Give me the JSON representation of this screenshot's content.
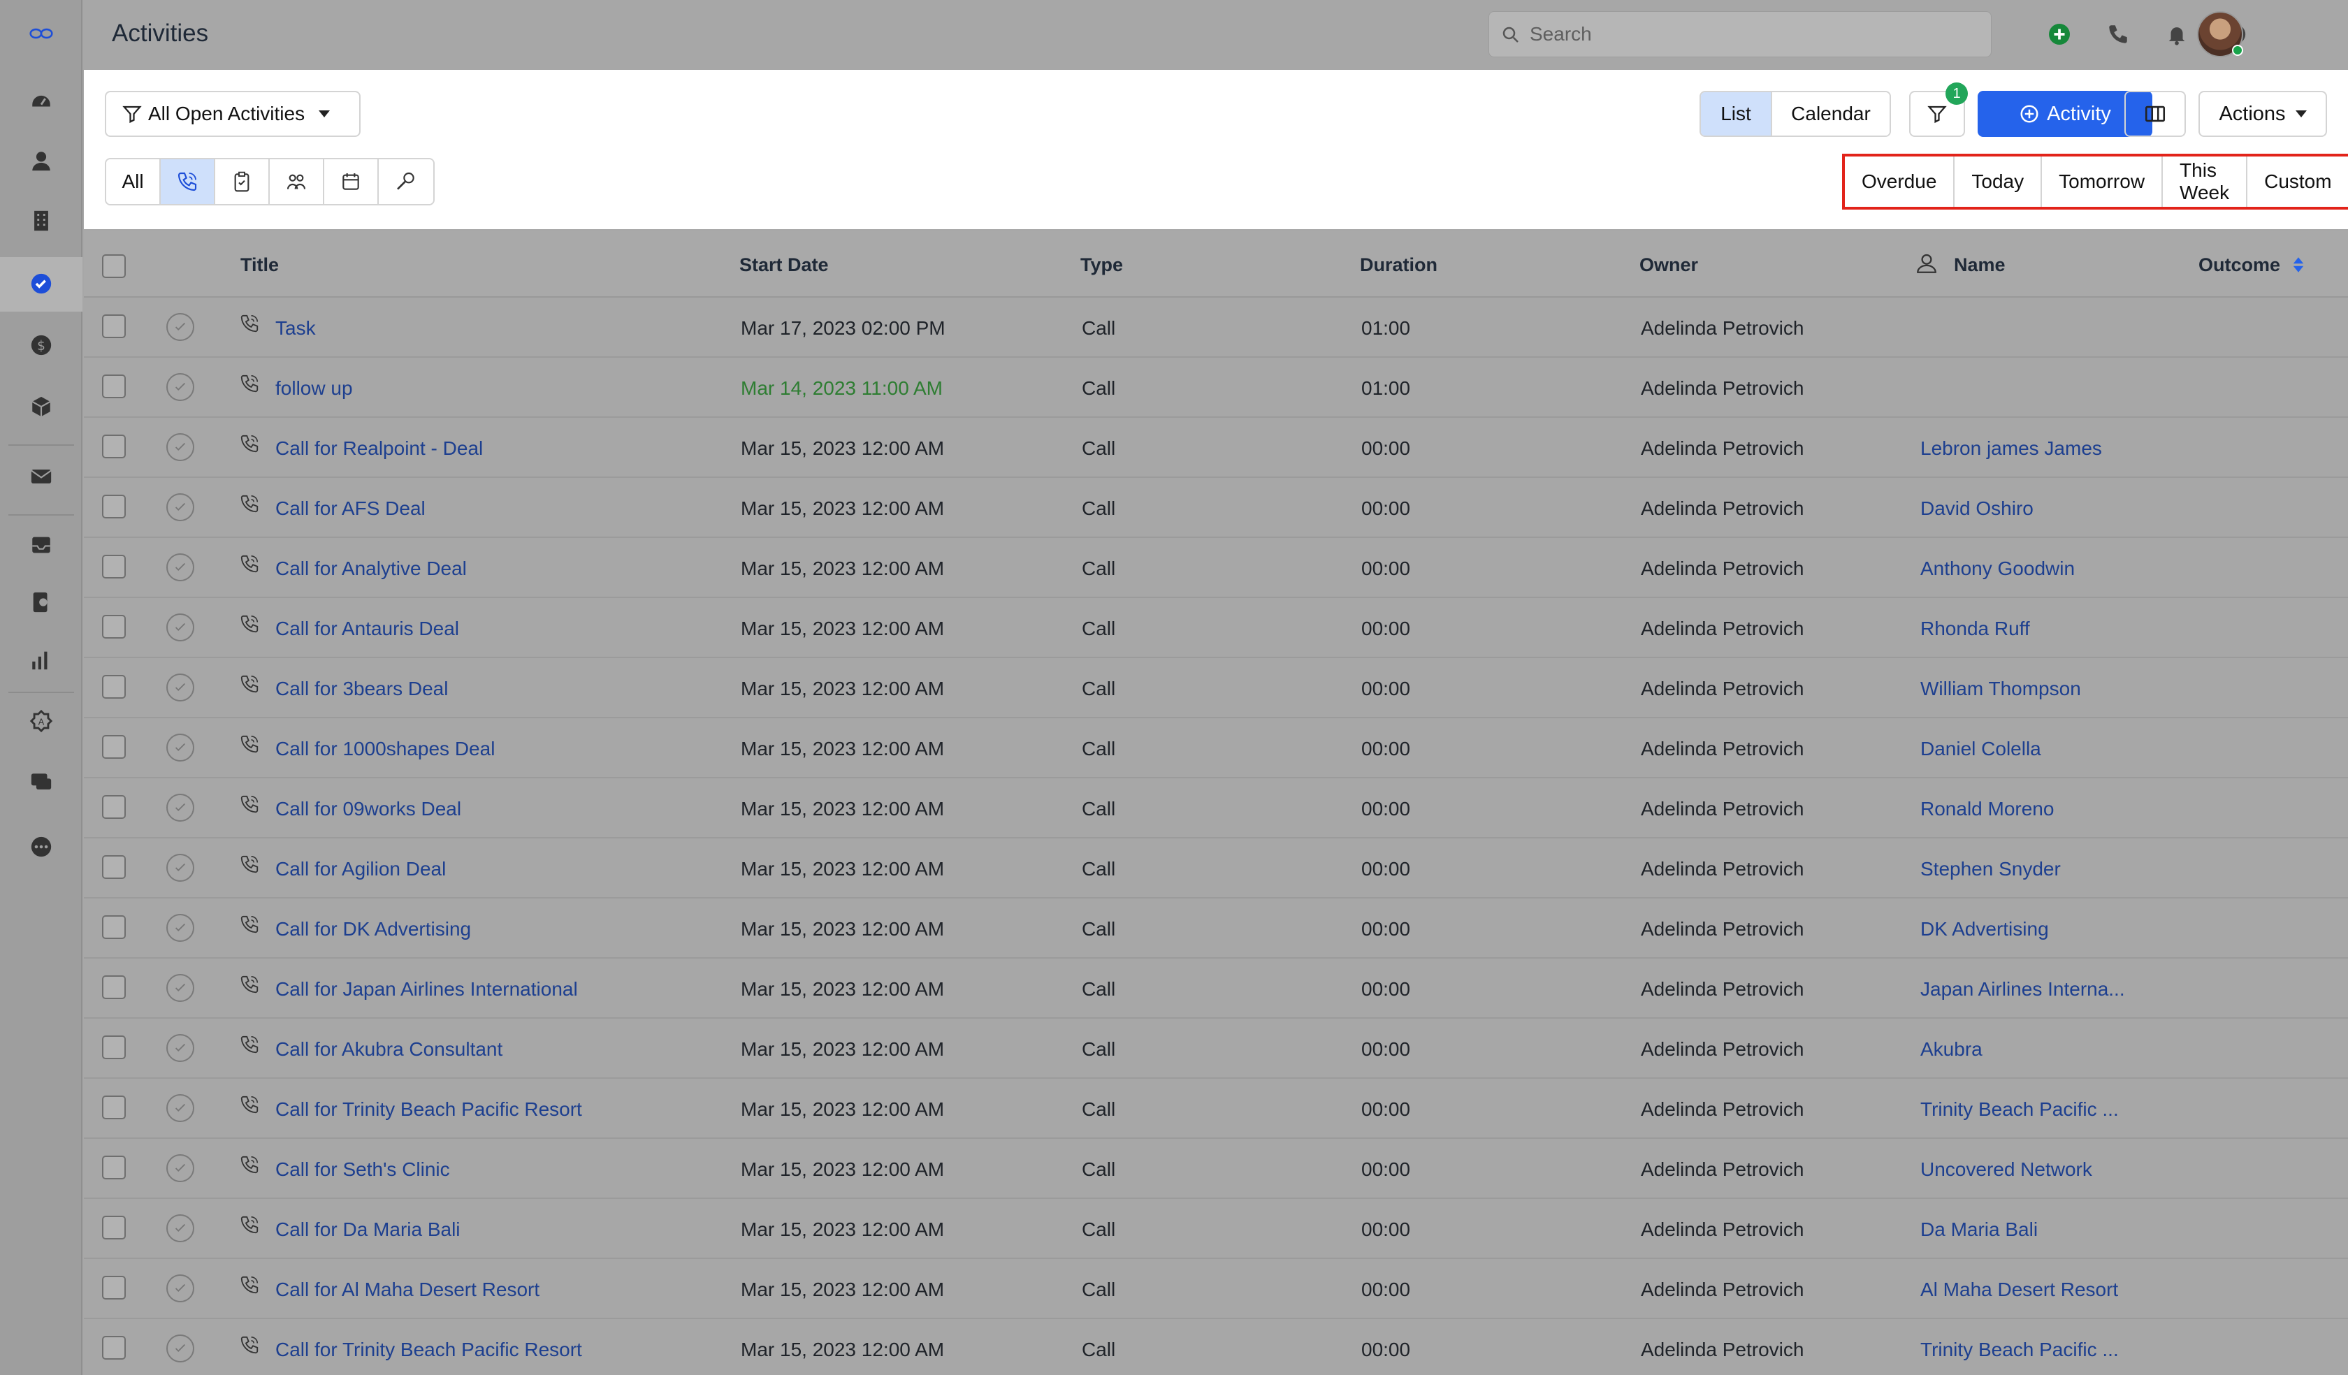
{
  "header": {
    "title": "Activities"
  },
  "search": {
    "placeholder": "Search"
  },
  "toolbar": {
    "view_filter": "All Open Activities",
    "view_modes": [
      "List",
      "Calendar"
    ],
    "filter_count": "1",
    "add_activity": "Activity",
    "actions": "Actions",
    "type_all": "All",
    "date_filters": [
      "Overdue",
      "Today",
      "Tomorrow",
      "This Week",
      "Custom"
    ]
  },
  "table": {
    "columns": {
      "title": "Title",
      "start_date": "Start Date",
      "type": "Type",
      "duration": "Duration",
      "owner": "Owner",
      "name": "Name",
      "outcome": "Outcome"
    },
    "rows": [
      {
        "title": "Task",
        "start_date": "Mar 17, 2023 02:00 PM",
        "type": "Call",
        "duration": "01:00",
        "owner": "Adelinda Petrovich",
        "name": ""
      },
      {
        "title": "follow up",
        "start_date": "Mar 14, 2023 11:00 AM",
        "type": "Call",
        "duration": "01:00",
        "owner": "Adelinda Petrovich",
        "name": ""
      },
      {
        "title": "Call for Realpoint - Deal",
        "start_date": "Mar 15, 2023 12:00 AM",
        "type": "Call",
        "duration": "00:00",
        "owner": "Adelinda Petrovich",
        "name": "Lebron james James"
      },
      {
        "title": "Call for AFS Deal",
        "start_date": "Mar 15, 2023 12:00 AM",
        "type": "Call",
        "duration": "00:00",
        "owner": "Adelinda Petrovich",
        "name": "David Oshiro"
      },
      {
        "title": "Call for Analytive Deal",
        "start_date": "Mar 15, 2023 12:00 AM",
        "type": "Call",
        "duration": "00:00",
        "owner": "Adelinda Petrovich",
        "name": "Anthony Goodwin"
      },
      {
        "title": "Call for Antauris Deal",
        "start_date": "Mar 15, 2023 12:00 AM",
        "type": "Call",
        "duration": "00:00",
        "owner": "Adelinda Petrovich",
        "name": "Rhonda Ruff"
      },
      {
        "title": "Call for 3bears Deal",
        "start_date": "Mar 15, 2023 12:00 AM",
        "type": "Call",
        "duration": "00:00",
        "owner": "Adelinda Petrovich",
        "name": "William Thompson"
      },
      {
        "title": "Call for 1000shapes Deal",
        "start_date": "Mar 15, 2023 12:00 AM",
        "type": "Call",
        "duration": "00:00",
        "owner": "Adelinda Petrovich",
        "name": "Daniel Colella"
      },
      {
        "title": "Call for 09works Deal",
        "start_date": "Mar 15, 2023 12:00 AM",
        "type": "Call",
        "duration": "00:00",
        "owner": "Adelinda Petrovich",
        "name": "Ronald Moreno"
      },
      {
        "title": "Call for Agilion Deal",
        "start_date": "Mar 15, 2023 12:00 AM",
        "type": "Call",
        "duration": "00:00",
        "owner": "Adelinda Petrovich",
        "name": "Stephen Snyder"
      },
      {
        "title": "Call for DK Advertising",
        "start_date": "Mar 15, 2023 12:00 AM",
        "type": "Call",
        "duration": "00:00",
        "owner": "Adelinda Petrovich",
        "name": "DK Advertising"
      },
      {
        "title": "Call for Japan Airlines International",
        "start_date": "Mar 15, 2023 12:00 AM",
        "type": "Call",
        "duration": "00:00",
        "owner": "Adelinda Petrovich",
        "name": "Japan Airlines Interna..."
      },
      {
        "title": "Call for Akubra Consultant",
        "start_date": "Mar 15, 2023 12:00 AM",
        "type": "Call",
        "duration": "00:00",
        "owner": "Adelinda Petrovich",
        "name": "Akubra"
      },
      {
        "title": "Call for Trinity Beach Pacific Resort",
        "start_date": "Mar 15, 2023 12:00 AM",
        "type": "Call",
        "duration": "00:00",
        "owner": "Adelinda Petrovich",
        "name": "Trinity Beach Pacific ..."
      },
      {
        "title": "Call for Seth's Clinic",
        "start_date": "Mar 15, 2023 12:00 AM",
        "type": "Call",
        "duration": "00:00",
        "owner": "Adelinda Petrovich",
        "name": "Uncovered Network"
      },
      {
        "title": "Call for Da Maria Bali",
        "start_date": "Mar 15, 2023 12:00 AM",
        "type": "Call",
        "duration": "00:00",
        "owner": "Adelinda Petrovich",
        "name": "Da Maria Bali"
      },
      {
        "title": "Call for Al Maha Desert Resort",
        "start_date": "Mar 15, 2023 12:00 AM",
        "type": "Call",
        "duration": "00:00",
        "owner": "Adelinda Petrovich",
        "name": "Al Maha Desert Resort"
      },
      {
        "title": "Call for Trinity Beach Pacific Resort",
        "start_date": "Mar 15, 2023 12:00 AM",
        "type": "Call",
        "duration": "00:00",
        "owner": "Adelinda Petrovich",
        "name": "Trinity Beach Pacific ..."
      }
    ]
  },
  "colors": {
    "accent": "#2563eb",
    "link": "#1d3f8f",
    "overdue_green": "#2e7d32",
    "highlight_box": "#e2231a",
    "badge": "#22a65a"
  }
}
